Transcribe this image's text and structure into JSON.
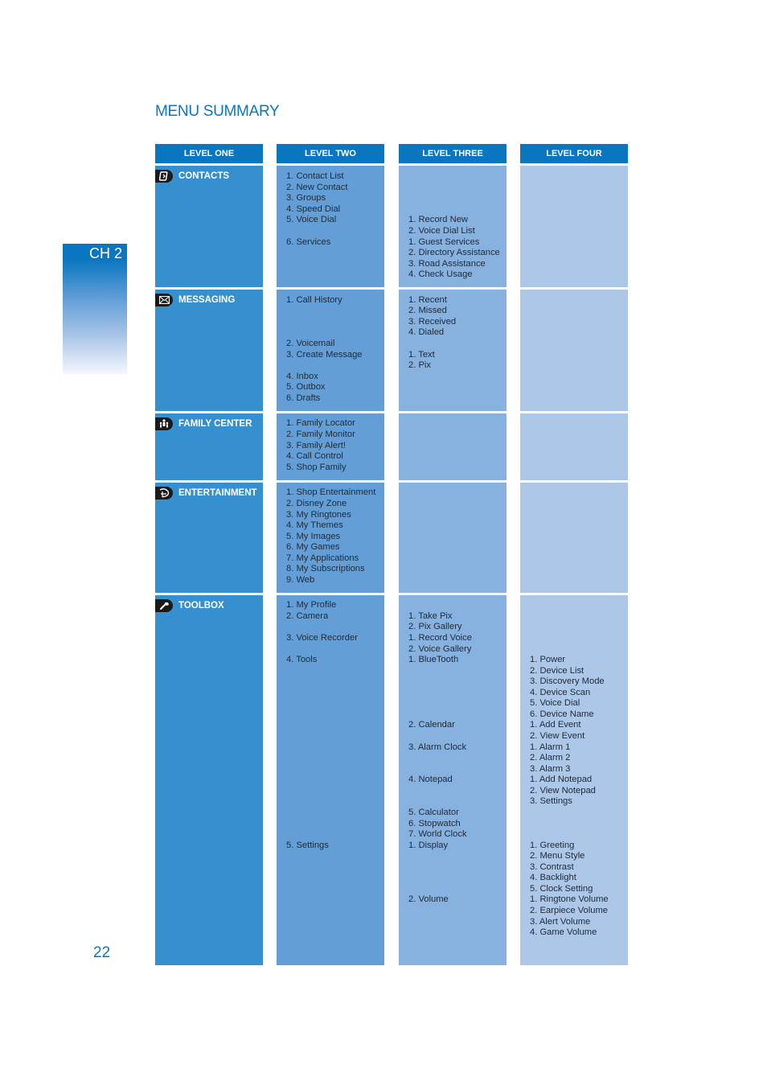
{
  "page": {
    "title": "MENU SUMMARY",
    "chapter_tab": "CH 2",
    "page_number": "22",
    "colors": {
      "accent": "#0a76bf",
      "level_one_bg": "#368fce",
      "level_two_bg": "#639fd6",
      "level_three_bg": "#87b1de",
      "level_four_bg": "#adc7e8",
      "item_text": "#1f2a38"
    }
  },
  "columns": [
    "LEVEL ONE",
    "LEVEL TWO",
    "LEVEL THREE",
    "LEVEL FOUR"
  ],
  "sections": [
    {
      "name": "CONTACTS",
      "icon": "contacts-book-icon",
      "level_two": [
        "1. Contact List",
        "2. New Contact",
        "3. Groups",
        "4. Speed Dial",
        "5. Voice Dial",
        "6. Services"
      ],
      "level_three": [
        "1. Record New",
        "2. Voice Dial List",
        "1. Guest Services",
        "2. Directory Assistance",
        "3. Road Assistance",
        "4. Check Usage"
      ],
      "level_four": []
    },
    {
      "name": "MESSAGING",
      "icon": "envelope-icon",
      "level_two": [
        "1. Call History",
        "2. Voicemail",
        "3. Create Message",
        "4. Inbox",
        "5. Outbox",
        "6. Drafts"
      ],
      "level_three": [
        "1. Recent",
        "2. Missed",
        "3. Received",
        "4. Dialed",
        "1. Text",
        "2. Pix"
      ],
      "level_four": []
    },
    {
      "name": "FAMILY CENTER",
      "icon": "family-icon",
      "level_two": [
        "1. Family Locator",
        "2. Family Monitor",
        "3. Family Alert!",
        "4. Call Control",
        "5. Shop Family"
      ],
      "level_three": [],
      "level_four": []
    },
    {
      "name": "ENTERTAINMENT",
      "icon": "disney-d-icon",
      "level_two": [
        "1. Shop Entertainment",
        "2. Disney Zone",
        "3. My Ringtones",
        "4. My Themes",
        "5. My Images",
        "6. My Games",
        "7. My Applications",
        "8. My Subscriptions",
        "9. Web"
      ],
      "level_three": [],
      "level_four": []
    },
    {
      "name": "TOOLBOX",
      "icon": "wrench-icon",
      "level_two": [
        "1. My Profile",
        "2. Camera",
        "3. Voice Recorder",
        "4. Tools",
        "5. Settings"
      ],
      "level_three": [
        "1. Take Pix",
        "2. Pix Gallery",
        "1. Record Voice",
        "2. Voice Gallery",
        "1. BlueTooth",
        "2. Calendar",
        "3. Alarm Clock",
        "4. Notepad",
        "5. Calculator",
        "6. Stopwatch",
        "7. World Clock",
        "1. Display",
        "2. Volume"
      ],
      "level_four": [
        "1. Power",
        "2. Device List",
        "3. Discovery Mode",
        "4. Device Scan",
        "5. Voice Dial",
        "6. Device Name",
        "1. Add Event",
        "2. View Event",
        "1. Alarm 1",
        "2. Alarm 2",
        "3. Alarm 3",
        "1. Add Notepad",
        "2. View Notepad",
        "3. Settings",
        "1. Greeting",
        "2. Menu Style",
        "3. Contrast",
        "4. Backlight",
        "5. Clock Setting",
        "1. Ringtone Volume",
        "2. Earpiece Volume",
        "3. Alert Volume",
        "4. Game Volume"
      ]
    }
  ]
}
